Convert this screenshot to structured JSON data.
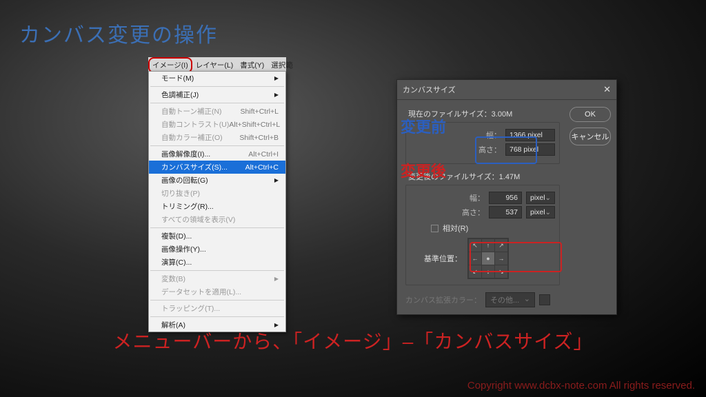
{
  "title": "カンバス変更の操作",
  "caption": "メニューバーから、「イメージ」–「カンバスサイズ」",
  "copyright": "Copyright www.dcbx-note.com All rights reserved.",
  "menubar": {
    "image": "イメージ(I)",
    "layer": "レイヤー(L)",
    "format": "書式(Y)",
    "select": "選択範"
  },
  "menu": {
    "mode": "モード(M)",
    "adjust": "色調補正(J)",
    "autoTone": "自動トーン補正(N)",
    "autoToneKey": "Shift+Ctrl+L",
    "autoContrast": "自動コントラスト(U)",
    "autoContrastKey": "Alt+Shift+Ctrl+L",
    "autoColor": "自動カラー補正(O)",
    "autoColorKey": "Shift+Ctrl+B",
    "imageSize": "画像解像度(I)...",
    "imageSizeKey": "Alt+Ctrl+I",
    "canvasSize": "カンバスサイズ(S)...",
    "canvasSizeKey": "Alt+Ctrl+C",
    "rotate": "画像の回転(G)",
    "crop": "切り抜き(P)",
    "trim": "トリミング(R)...",
    "revealAll": "すべての領域を表示(V)",
    "duplicate": "複製(D)...",
    "apply": "画像操作(Y)...",
    "calc": "演算(C)...",
    "variables": "変数(B)",
    "datasets": "データセットを適用(L)...",
    "trap": "トラッピング(T)...",
    "analysis": "解析(A)"
  },
  "dialog": {
    "title": "カンバスサイズ",
    "currentLabel": "現在のファイルサイズ：",
    "currentSize": "3.00M",
    "widthLabel": "幅：",
    "heightLabel": "高さ：",
    "curWidth": "1366 pixel",
    "curHeight": "768 pixel",
    "newLabel": "変更後のファイルサイズ：",
    "newSize": "1.47M",
    "newWidth": "956",
    "newHeight": "537",
    "unit": "pixel",
    "relative": "相対(R)",
    "anchor": "基準位置：",
    "extension": "カンバス拡張カラー：",
    "extValue": "その他...",
    "ok": "OK",
    "cancel": "キャンセル",
    "annBefore": "変更前",
    "annAfter": "変更後"
  }
}
